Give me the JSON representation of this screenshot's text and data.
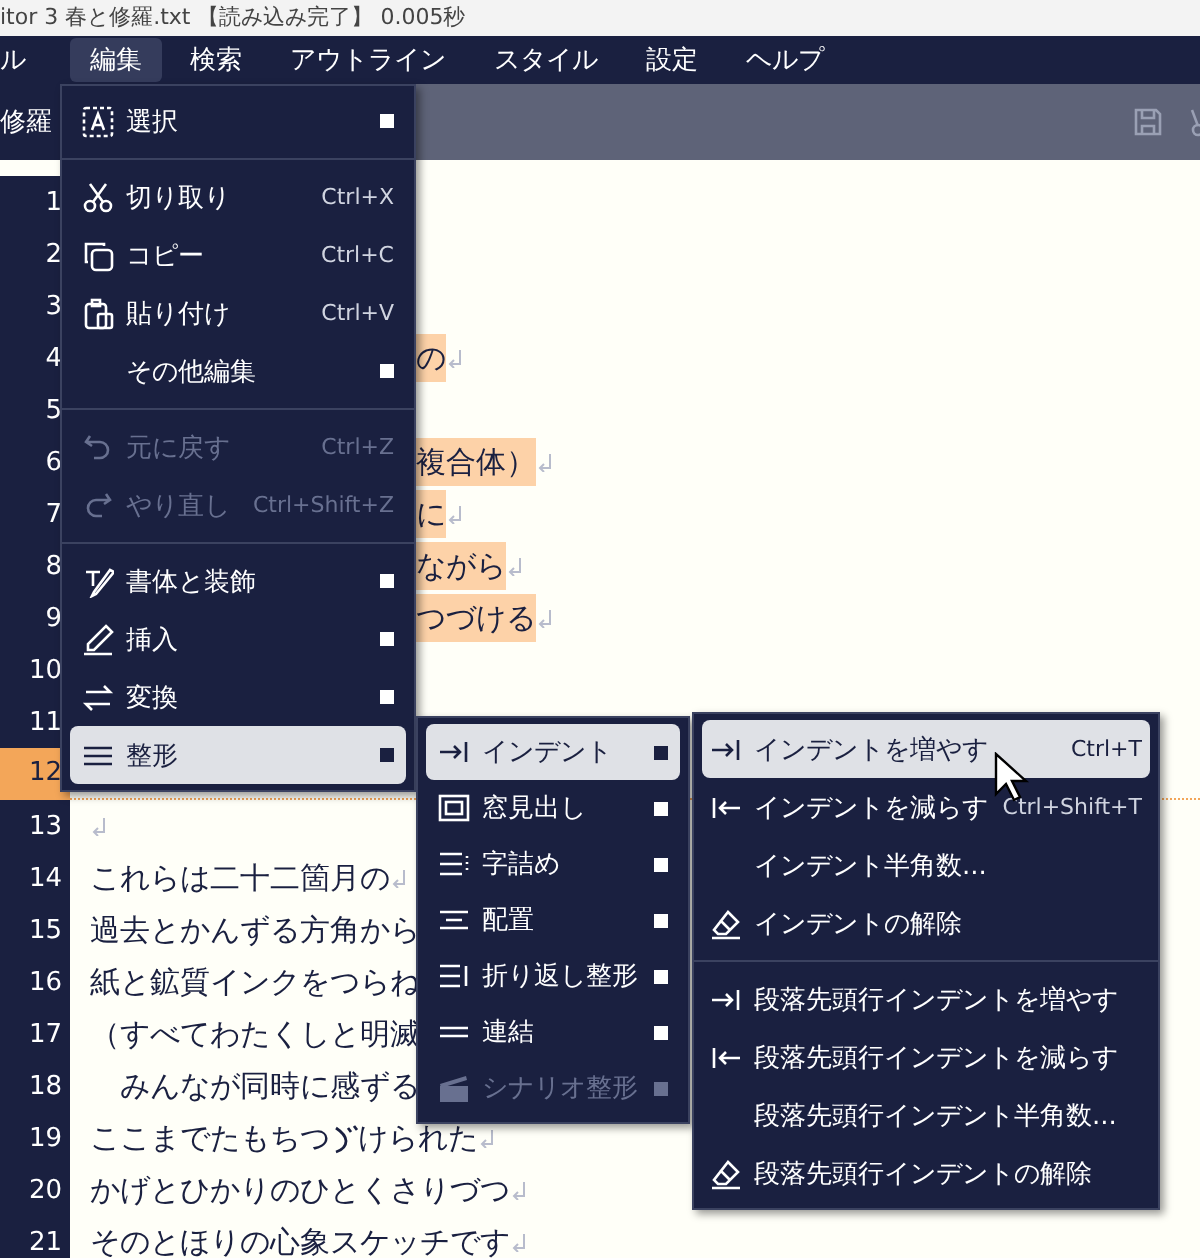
{
  "window": {
    "title": "itor 3  春と修羅.txt 【読み込み完了】 0.005秒"
  },
  "menubar": [
    {
      "label": "ル",
      "selected": false
    },
    {
      "label": "編集",
      "selected": true
    },
    {
      "label": "検索",
      "selected": false
    },
    {
      "label": "アウトライン",
      "selected": false
    },
    {
      "label": "スタイル",
      "selected": false
    },
    {
      "label": "設定",
      "selected": false
    },
    {
      "label": "ヘルプ",
      "selected": false
    }
  ],
  "toolbar": {
    "tab": "修羅"
  },
  "editor": {
    "lines": [
      {
        "number": "1"
      },
      {
        "number": "2"
      },
      {
        "number": "3"
      },
      {
        "number": "4",
        "text": "の",
        "eol": true,
        "selected": true
      },
      {
        "number": "5"
      },
      {
        "number": "6",
        "text": "複合体）",
        "eol": true,
        "selected": true
      },
      {
        "number": "7",
        "text": "に",
        "eol": true,
        "selected": true
      },
      {
        "number": "8",
        "text": "ながら",
        "eol": true,
        "selected": true
      },
      {
        "number": "9",
        "text": "つづける",
        "eol": true,
        "selected": true
      },
      {
        "number": "10"
      },
      {
        "number": "11"
      },
      {
        "number": "12",
        "current": true
      },
      {
        "number": "13",
        "eol": true
      },
      {
        "number": "14",
        "text": "これらは二十二箇月の",
        "eol": true,
        "selected": false
      },
      {
        "number": "15",
        "text": "過去とかんずる方角から",
        "selected": false
      },
      {
        "number": "16",
        "text": "紙と鉱質インクをつらね",
        "selected": false
      },
      {
        "number": "17",
        "text": "（すべてわたくしと明滅",
        "selected": false
      },
      {
        "number": "18",
        "text": "　みんなが同時に感ずる",
        "selected": false
      },
      {
        "number": "19",
        "text": "ここまでたもちつ",
        "text_after_iteration_mark": "けられた",
        "eol": true,
        "selected": false
      },
      {
        "number": "20",
        "text": "かげとひかりのひとくさりづつ",
        "eol": true,
        "selected": false
      },
      {
        "number": "21",
        "text": "そのとほりの心象スケッチです",
        "eol": true,
        "selected": false
      }
    ]
  },
  "menus": [
    {
      "items": [
        {
          "kind": "item",
          "label": "選択",
          "submenu": true,
          "disabled": false,
          "selected": false
        },
        {
          "kind": "separator"
        },
        {
          "kind": "item",
          "label": "切り取り",
          "shortcut": "Ctrl+X",
          "submenu": false,
          "disabled": false,
          "selected": false
        },
        {
          "kind": "item",
          "label": "コピー",
          "shortcut": "Ctrl+C",
          "submenu": false,
          "disabled": false,
          "selected": false
        },
        {
          "kind": "item",
          "label": "貼り付け",
          "shortcut": "Ctrl+V",
          "submenu": false,
          "disabled": false,
          "selected": false
        },
        {
          "kind": "item",
          "label": "その他編集",
          "submenu": true,
          "disabled": false,
          "selected": false
        },
        {
          "kind": "separator"
        },
        {
          "kind": "item",
          "label": "元に戻す",
          "shortcut": "Ctrl+Z",
          "submenu": false,
          "disabled": true,
          "selected": false
        },
        {
          "kind": "item",
          "label": "やり直し",
          "shortcut": "Ctrl+Shift+Z",
          "submenu": false,
          "disabled": true,
          "selected": false
        },
        {
          "kind": "separator"
        },
        {
          "kind": "item",
          "label": "書体と装飾",
          "submenu": true,
          "disabled": false,
          "selected": false
        },
        {
          "kind": "item",
          "label": "挿入",
          "submenu": true,
          "disabled": false,
          "selected": false
        },
        {
          "kind": "item",
          "label": "変換",
          "submenu": true,
          "disabled": false,
          "selected": false
        },
        {
          "kind": "item",
          "label": "整形",
          "submenu": true,
          "disabled": false,
          "selected": true
        }
      ]
    },
    {
      "items": [
        {
          "kind": "item",
          "label": "インデント",
          "submenu": true,
          "disabled": false,
          "selected": true
        },
        {
          "kind": "item",
          "label": "窓見出し",
          "submenu": true,
          "disabled": false,
          "selected": false
        },
        {
          "kind": "item",
          "label": "字詰め",
          "submenu": true,
          "disabled": false,
          "selected": false
        },
        {
          "kind": "item",
          "label": "配置",
          "submenu": true,
          "disabled": false,
          "selected": false
        },
        {
          "kind": "item",
          "label": "折り返し整形",
          "submenu": true,
          "disabled": false,
          "selected": false
        },
        {
          "kind": "item",
          "label": "連結",
          "submenu": true,
          "disabled": false,
          "selected": false
        },
        {
          "kind": "item",
          "label": "シナリオ整形",
          "submenu": true,
          "disabled": true,
          "selected": false
        }
      ]
    },
    {
      "items": [
        {
          "kind": "item",
          "label": "インデントを増やす",
          "shortcut": "Ctrl+T",
          "submenu": false,
          "disabled": false,
          "selected": true
        },
        {
          "kind": "item",
          "label": "インデントを減らす",
          "shortcut": "Ctrl+Shift+T",
          "submenu": false,
          "disabled": false,
          "selected": false
        },
        {
          "kind": "item",
          "label": "インデント半角数...",
          "submenu": false,
          "disabled": false,
          "selected": false
        },
        {
          "kind": "item",
          "label": "インデントの解除",
          "submenu": false,
          "disabled": false,
          "selected": false
        },
        {
          "kind": "separator"
        },
        {
          "kind": "item",
          "label": "段落先頭行インデントを増やす",
          "submenu": false,
          "disabled": false,
          "selected": false
        },
        {
          "kind": "item",
          "label": "段落先頭行インデントを減らす",
          "submenu": false,
          "disabled": false,
          "selected": false
        },
        {
          "kind": "item",
          "label": "段落先頭行インデント半角数...",
          "submenu": false,
          "disabled": false,
          "selected": false
        },
        {
          "kind": "item",
          "label": "段落先頭行インデントの解除",
          "submenu": false,
          "disabled": false,
          "selected": false
        }
      ]
    }
  ]
}
